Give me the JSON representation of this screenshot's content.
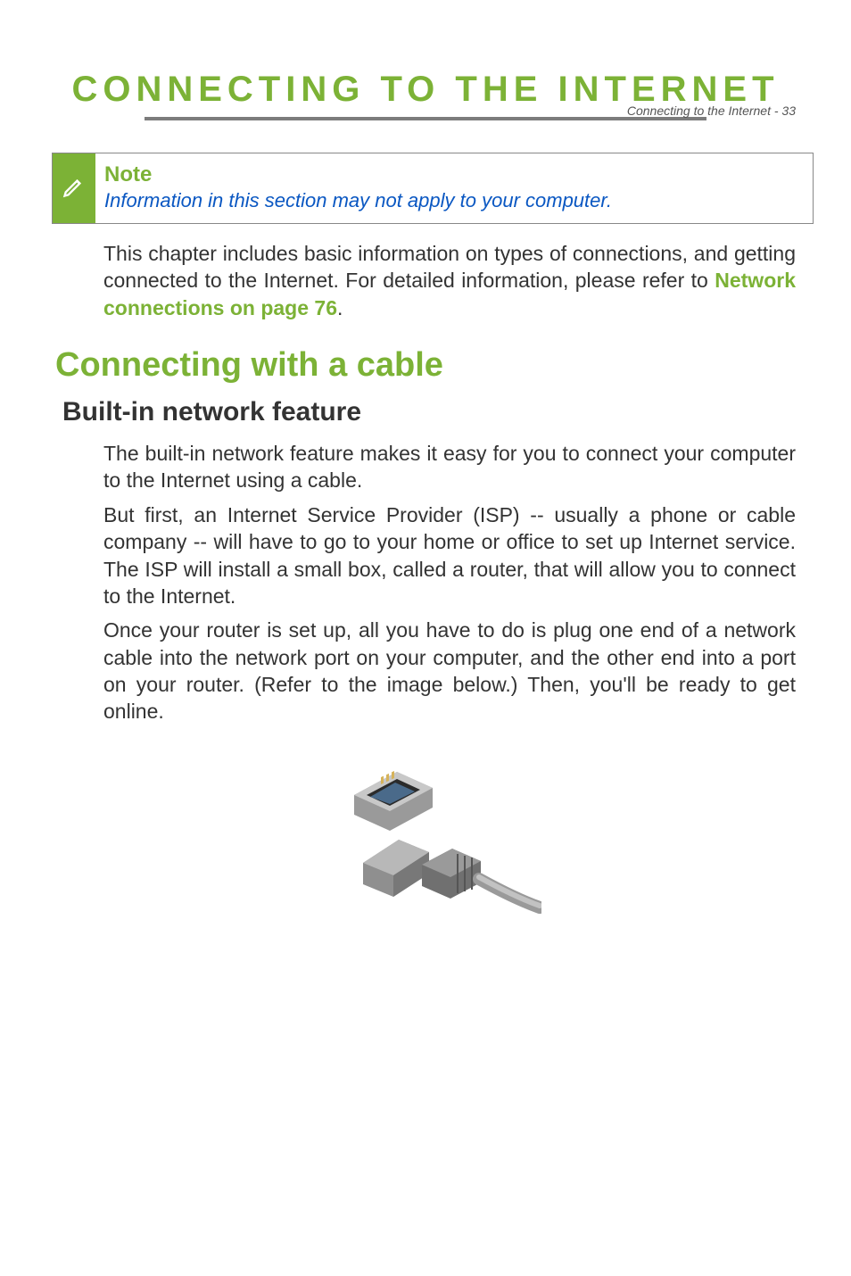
{
  "header": {
    "breadcrumb": "Connecting to the Internet - 33"
  },
  "title": "CONNECTING TO THE INTERNET",
  "note": {
    "label": "Note",
    "text": "Information in this section may not apply to your computer."
  },
  "intro": {
    "before_link": "This chapter includes basic information on types of connections, and getting connected to the Internet. For detailed information, please refer to ",
    "link_text": "Network connections on page 76",
    "after_link": "."
  },
  "section_h1": "Connecting with a cable",
  "section_h2": "Built-in network feature",
  "paragraphs": {
    "p1": "The built-in network feature makes it easy for you to connect your computer to the Internet using a cable.",
    "p2": "But first, an Internet Service Provider (ISP) -- usually a phone or cable company -- will have to go to your home or office to set up Internet service. The ISP will install a small box, called a router, that will allow you to connect to the Internet.",
    "p3": "Once your router is set up, all you have to do is plug one end of a network cable into the network port on your computer, and the other end into a port on your router. (Refer to the image below.) Then, you'll be ready to get online."
  },
  "image_alt": "Ethernet port and cable illustration"
}
